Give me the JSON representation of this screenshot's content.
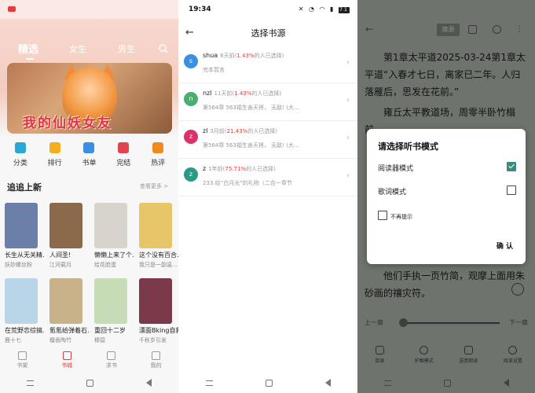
{
  "store": {
    "tabs": [
      "精选",
      "女生",
      "男生"
    ],
    "banner_title": "我的仙妖女友",
    "categories": [
      {
        "label": "分类",
        "color": "#2aa7d6"
      },
      {
        "label": "排行",
        "color": "#f2b01e"
      },
      {
        "label": "书单",
        "color": "#3a8fe0"
      },
      {
        "label": "完结",
        "color": "#e0454f"
      },
      {
        "label": "热评",
        "color": "#f08a1e"
      }
    ],
    "section_title": "追追上新",
    "section_more": "查看更多 >",
    "books": [
      {
        "title": "长生从无关精…",
        "author": "妖妙螺丝粉",
        "color": "#6b7fa8"
      },
      {
        "title": "人间圣!",
        "author": "江河载月",
        "color": "#8a6a4a"
      },
      {
        "title": "懒懒上来了个…",
        "author": "给花脸蛋",
        "color": "#d8d4cc"
      },
      {
        "title": "这个没有百合…",
        "author": "我只是一副温…",
        "color": "#e7c66a"
      },
      {
        "title": "在荒野恋综搞…",
        "author": "鹿十七",
        "color": "#b8d6e8"
      },
      {
        "title": "氪氪给弹着石…",
        "author": "檀香陶竹",
        "color": "#c8b28a"
      },
      {
        "title": "重回十二岁",
        "author": "穆碧",
        "color": "#c6dcb6"
      },
      {
        "title": "漂面Bking自救…",
        "author": "千秋岁引发",
        "color": "#7a3a4a"
      }
    ],
    "nav": [
      "书架",
      "书城",
      "求书",
      "我的"
    ],
    "nav_active": "书城"
  },
  "sources": {
    "status_time": "19:34",
    "battery": "71",
    "title": "选择书源",
    "items": [
      {
        "avatar": "s",
        "color": "#3a8fe0",
        "name": "shua",
        "time": "6天前",
        "pct": "1.43%",
        "suffix": "的人已选择",
        "latest": "完本暂言"
      },
      {
        "avatar": "n",
        "color": "#4cae6e",
        "name": "nzl",
        "time": "11天前",
        "pct": "1.43%",
        "suffix": "的人已选择",
        "latest": "第564章 563福生善天将， 无敌!   (大…"
      },
      {
        "avatar": "z",
        "color": "#d9336a",
        "name": "zl",
        "time": "3月前",
        "pct": "21.43%",
        "suffix": "的人已选择",
        "latest": "第564章 563福生善天将， 无敌!   (大…"
      },
      {
        "avatar": "z",
        "color": "#2a9a86",
        "name": "z",
        "time": "1年前",
        "pct": "75.71%",
        "suffix": "的人已选择",
        "latest": "233.给“白月光”的礼物（二合一章节"
      }
    ]
  },
  "reader": {
    "change_source": "换源",
    "paragraph1": "第1章太平道2025-03-24第1章太平道“入春才七日，离家已二年。人归落雁后，思发在花前。”",
    "paragraph2": "雍丘太平教道场，周零半卧竹榻前…",
    "paragraph3": "他们手执一页竹简，观摩上面用朱砂画的禳灾符。",
    "prev_chapter": "上一章",
    "next_chapter": "下一章",
    "progress": 0.0,
    "tools": [
      "目录",
      "护眼模式",
      "语音朗读",
      "阅读设置"
    ],
    "dialog": {
      "title": "请选择听书模式",
      "option1": "阅读器模式",
      "option1_checked": true,
      "option2": "歌词模式",
      "option2_checked": false,
      "no_more": "不再提示",
      "confirm": "确 认"
    }
  }
}
